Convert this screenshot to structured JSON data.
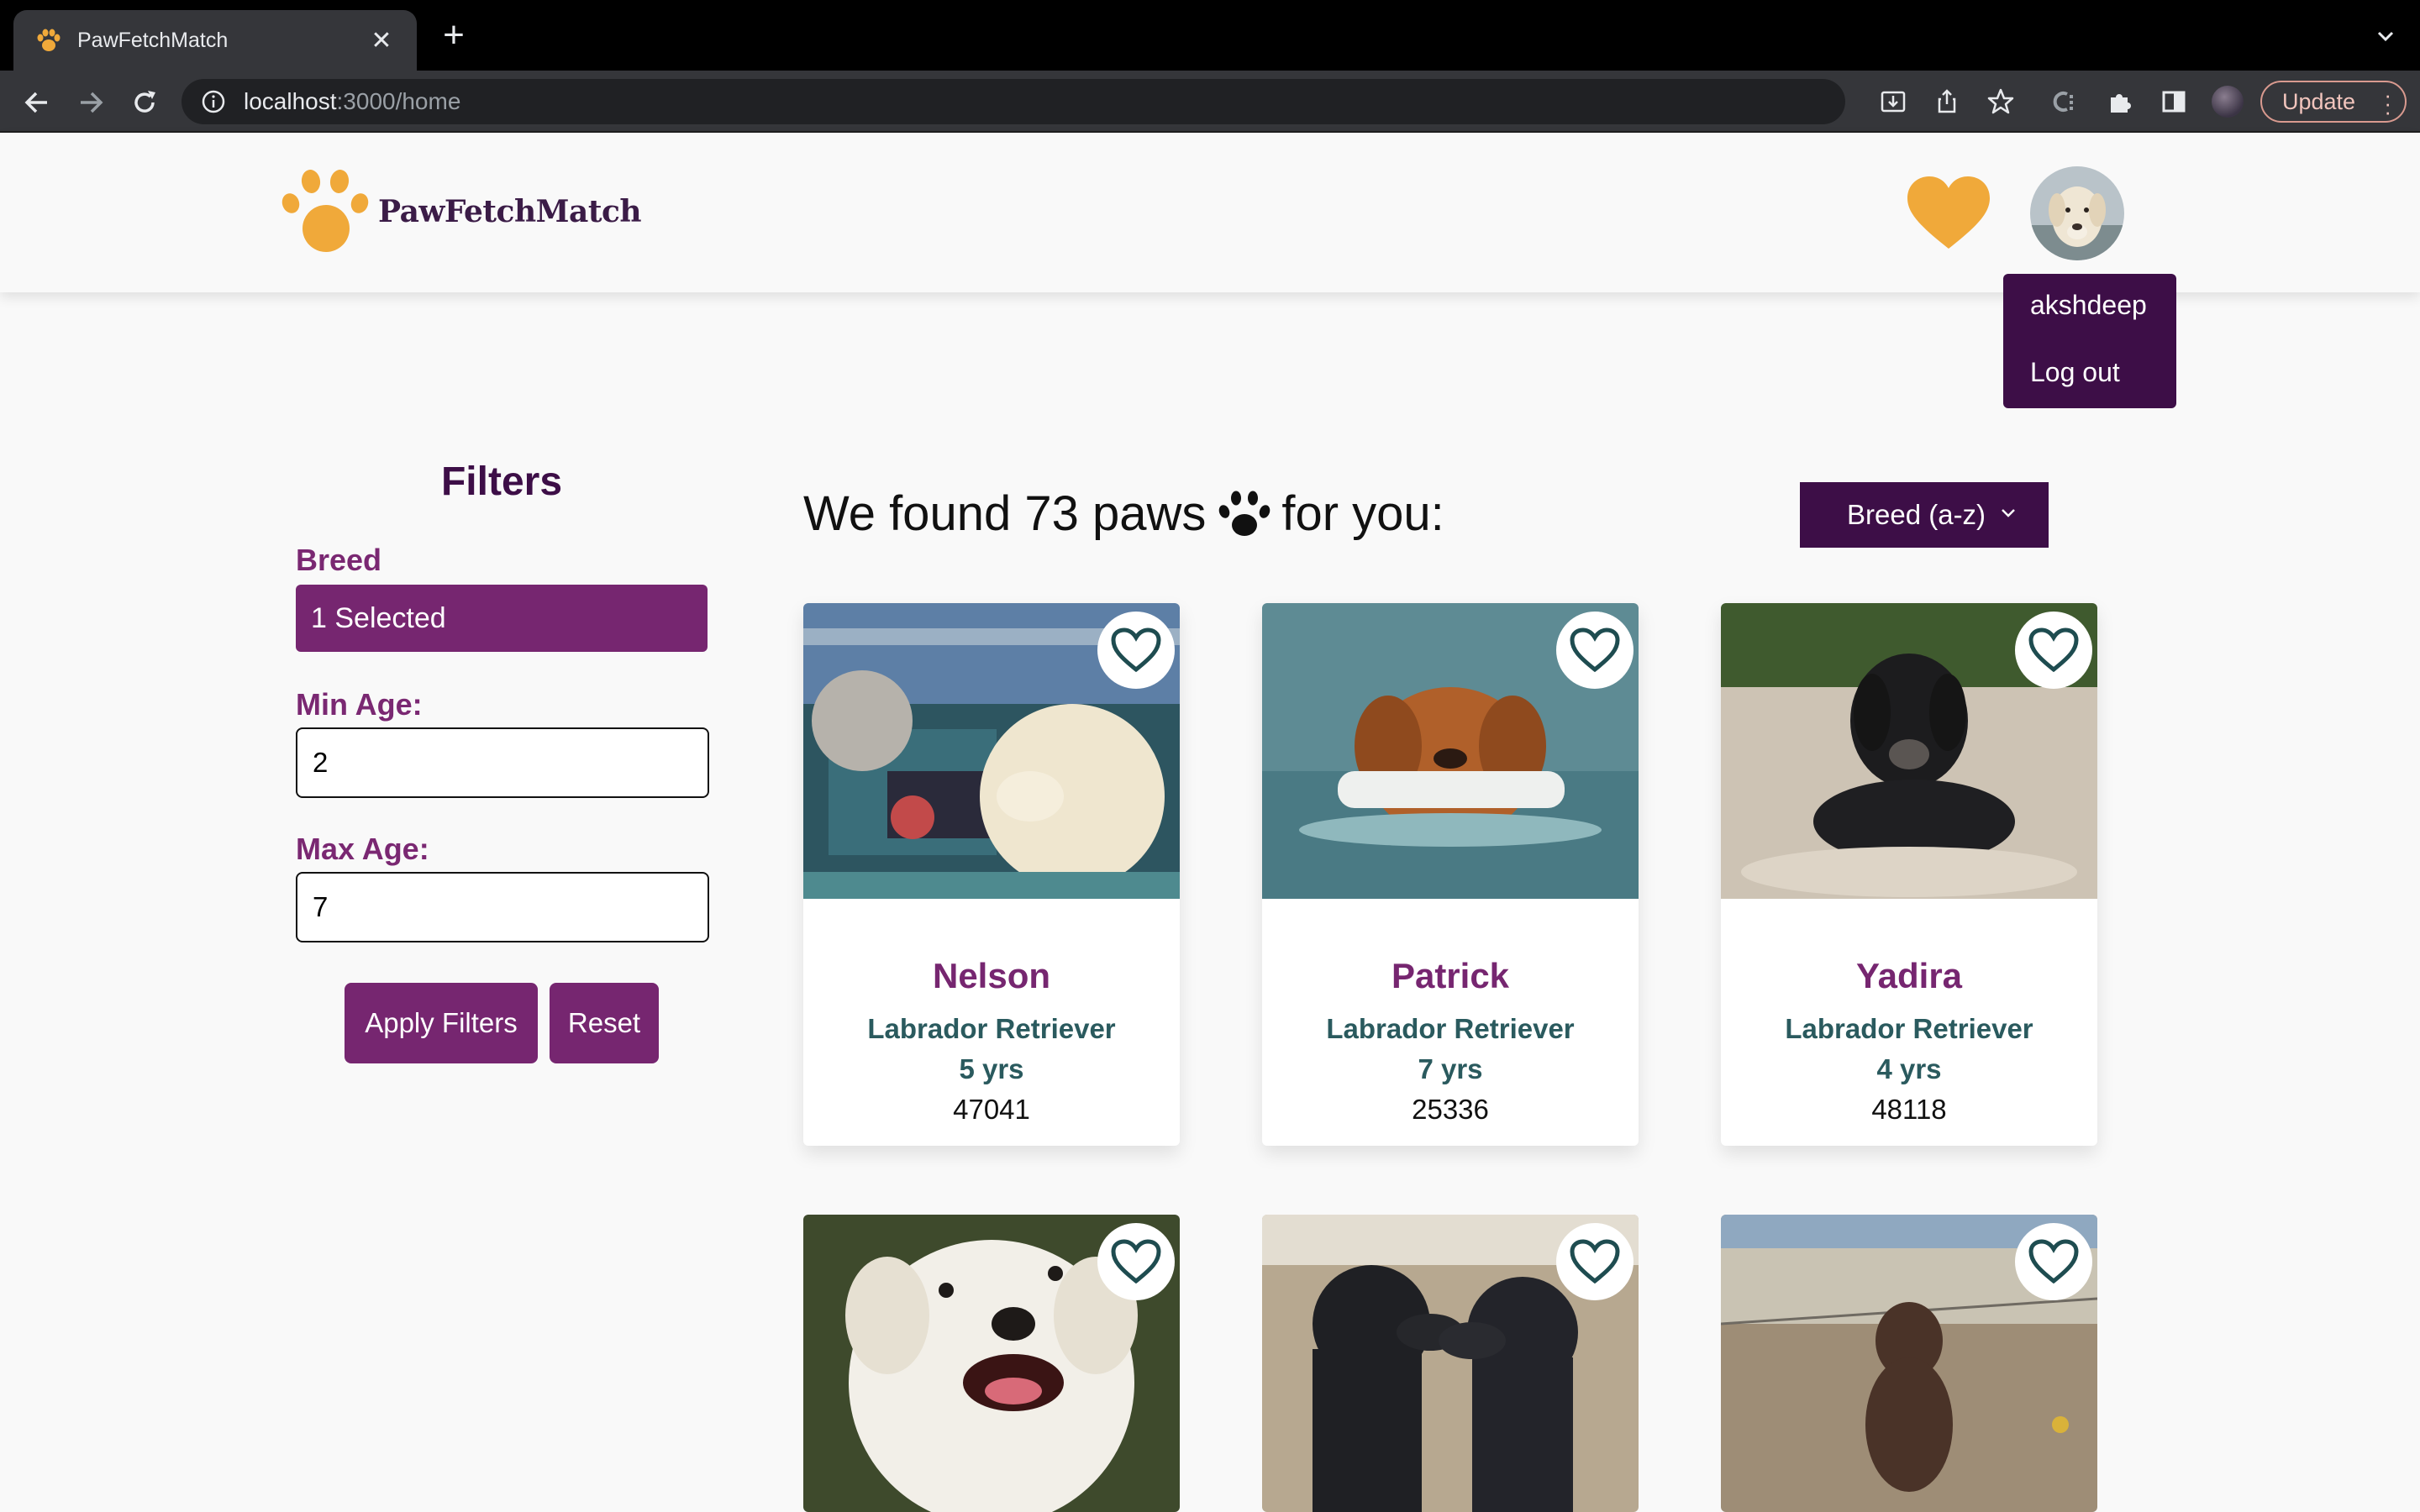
{
  "browser": {
    "tab_title": "PawFetchMatch",
    "url_host": "localhost",
    "url_path": ":3000/home",
    "update_label": "Update"
  },
  "app": {
    "logo_text": "PawFetchMatch",
    "brand_color": "#762670",
    "dark_purple": "#3d0e47",
    "accent_orange": "#f0a93a",
    "user_menu": {
      "username": "akshdeep",
      "logout": "Log out"
    }
  },
  "filters": {
    "title": "Filters",
    "breed_label": "Breed",
    "breed_value": "1 Selected",
    "min_age_label": "Min Age:",
    "min_age_value": "2",
    "max_age_label": "Max Age:",
    "max_age_value": "7",
    "apply_label": "Apply Filters",
    "reset_label": "Reset"
  },
  "results": {
    "title_prefix": "We found 73 paws",
    "title_suffix": "for you:",
    "sort_label": "Breed (a-z)",
    "dogs": [
      {
        "name": "Nelson",
        "breed": "Labrador Retriever",
        "age": "5 yrs",
        "zip": "47041"
      },
      {
        "name": "Patrick",
        "breed": "Labrador Retriever",
        "age": "7 yrs",
        "zip": "25336"
      },
      {
        "name": "Yadira",
        "breed": "Labrador Retriever",
        "age": "4 yrs",
        "zip": "48118"
      }
    ]
  }
}
